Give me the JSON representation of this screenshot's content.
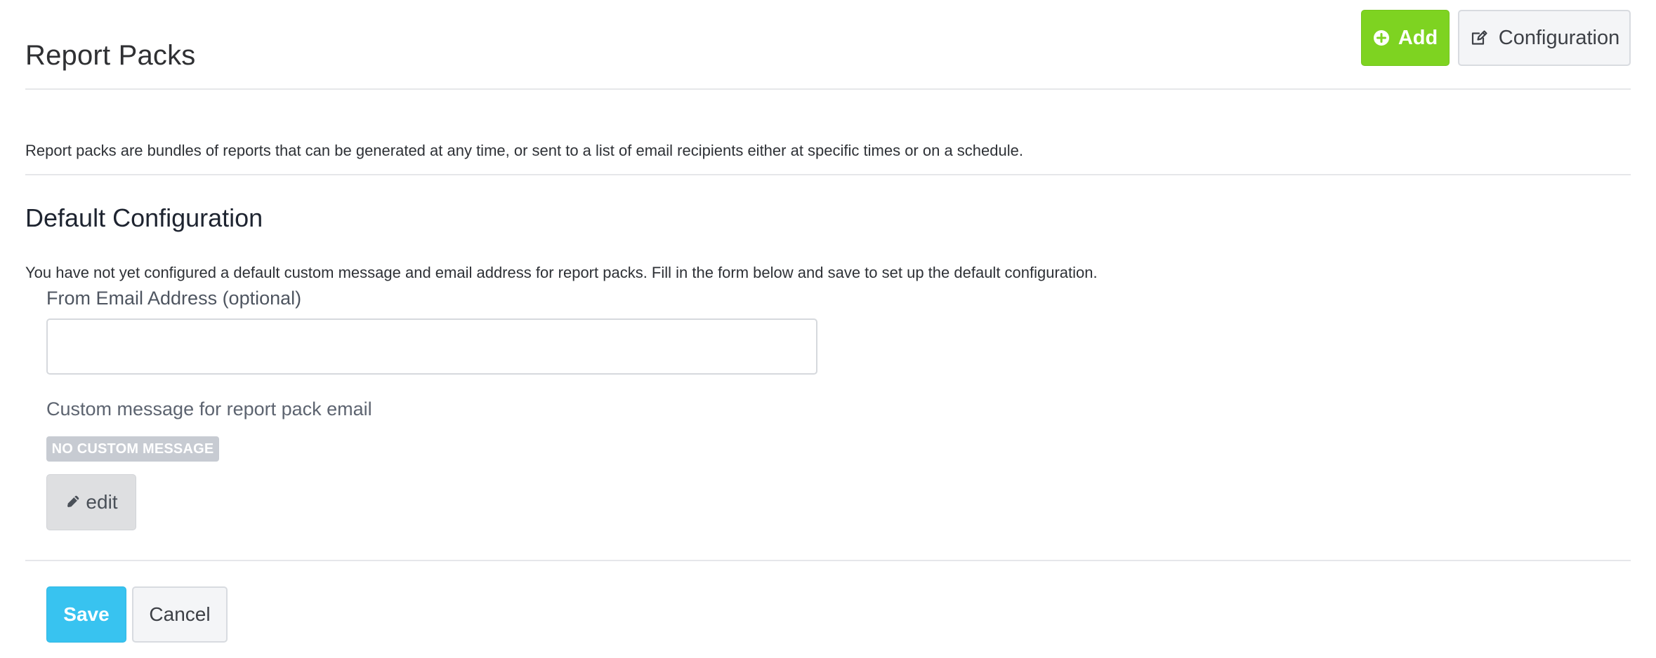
{
  "header": {
    "title": "Report Packs",
    "actions": {
      "add_label": "Add",
      "configuration_label": "Configuration",
      "add_icon": "plus-circle-icon",
      "configuration_icon": "edit-square-icon"
    }
  },
  "description": {
    "text": "Report packs are bundles of reports that can be generated at any time, or sent to a list of email recipients either at specific times or on a schedule."
  },
  "default_configuration": {
    "heading": "Default Configuration",
    "help_text": "You have not yet configured a default custom message and email address for report packs. Fill in the form below and save to set up the default configuration.",
    "from_email": {
      "label": "From Email Address (optional)",
      "value": "",
      "placeholder": ""
    },
    "custom_message": {
      "label": "Custom message for report pack email",
      "status": "NO CUSTOM MESSAGE",
      "edit_label": "edit",
      "edit_icon": "pencil-icon"
    }
  },
  "footer": {
    "save_label": "Save",
    "cancel_label": "Cancel"
  },
  "colors": {
    "add_button": "#7ed321",
    "save_button": "#38c3f0",
    "badge": "#c7cbd2",
    "border": "#e6e7ea"
  }
}
